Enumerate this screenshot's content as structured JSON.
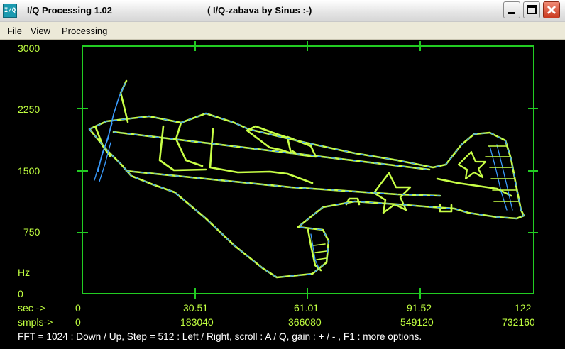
{
  "window": {
    "title": "I/Q Processing  1.02",
    "subtitle": "( I/Q-zabava by Sinus :-)",
    "icon_text": "I/Q",
    "icon": "iq-app-icon"
  },
  "menu": {
    "items": [
      "File",
      "View",
      "Processing"
    ]
  },
  "axes": {
    "y_ticks": [
      "3000",
      "2250",
      "1500",
      "750",
      "0"
    ],
    "y_unit": "Hz",
    "sec_label": "sec ->",
    "smpls_label": "smpls->",
    "sec_ticks": [
      "0",
      "30.51",
      "61.01",
      "91.52",
      "122"
    ],
    "smpl_ticks": [
      "0",
      "183040",
      "366080",
      "549120",
      "732160"
    ]
  },
  "status": "FFT = 1024 : Down / Up,    Step = 512 : Left / Right,    scroll : A / Q,    gain : + / - ,     F1 : more options.",
  "colors": {
    "axis": "#22cc22",
    "label": "#c0ff40",
    "trace_green": "#c8ff46",
    "trace_blue": "#3a9cff",
    "background": "#000000"
  }
}
